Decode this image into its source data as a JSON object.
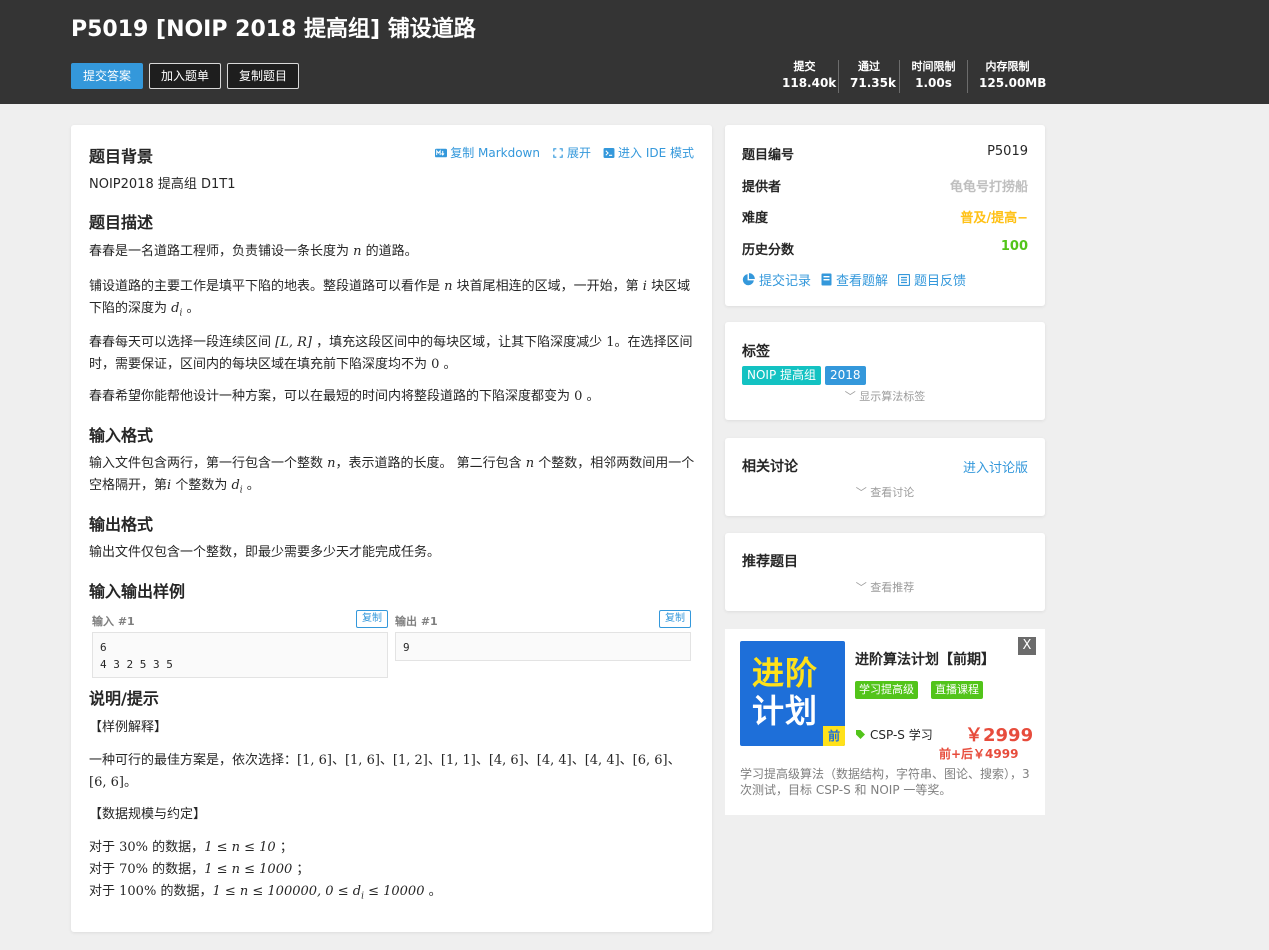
{
  "header": {
    "title": "P5019 [NOIP 2018 提高组] 铺设道路",
    "buttons": {
      "submit": "提交答案",
      "add_list": "加入题单",
      "copy": "复制题目"
    },
    "stats": [
      {
        "label": "提交",
        "value": "118.40k"
      },
      {
        "label": "通过",
        "value": "71.35k"
      },
      {
        "label": "时间限制",
        "value": "1.00s"
      },
      {
        "label": "内存限制",
        "value": "125.00MB"
      }
    ]
  },
  "problem": {
    "actions": {
      "copy_md": "复制 Markdown",
      "expand": "展开",
      "ide": "进入 IDE 模式"
    },
    "background": {
      "heading": "题目背景",
      "text": "NOIP2018 提高组 D1T1"
    },
    "description": {
      "heading": "题目描述",
      "p1a": "春春是一名道路工程师，负责铺设一条长度为 ",
      "p1_n": "n",
      "p1b": " 的道路。",
      "p2a": "铺设道路的主要工作是填平下陷的地表。整段道路可以看作是 ",
      "p2_n": "n",
      "p2b": " 块首尾相连的区域，一开始，第 ",
      "p2_i": "i",
      "p2c": " 块区域下陷的深度为 ",
      "p2_d": "d",
      "p2_sub": "i",
      "p2d": " 。",
      "p3a": "春春每天可以选择一段连续区间 ",
      "p3_lr": "[L, R]",
      "p3b": " ，填充这段区间中的每块区域，让其下陷深度减少 ",
      "p3_one": "1",
      "p3c": "。在选择区间时，需要保证，区间内的每块区域在填充前下陷深度均不为 ",
      "p3_zero": "0",
      "p3d": " 。",
      "p4a": "春春希望你能帮他设计一种方案，可以在最短的时间内将整段道路的下陷深度都变为 ",
      "p4_zero": "0",
      "p4b": " 。"
    },
    "input_format": {
      "heading": "输入格式",
      "a": "输入文件包含两行，第一行包含一个整数 ",
      "n1": "n",
      "b": "，表示道路的长度。 第二行包含 ",
      "n2": "n",
      "c": " 个整数，相邻两数间用一个空格隔开，第",
      "i": "i",
      "d": " 个整数为 ",
      "di": "d",
      "di_sub": "i",
      "e": " 。"
    },
    "output_format": {
      "heading": "输出格式",
      "text": "输出文件仅包含一个整数，即最少需要多少天才能完成任务。"
    },
    "samples": {
      "heading": "输入输出样例",
      "input_label": "输入 #1",
      "output_label": "输出 #1",
      "copy": "复制",
      "input_line1": "6",
      "input_line2": "4 3 2 5 3 5",
      "output": "9"
    },
    "hint": {
      "heading": "说明/提示",
      "sample_expl": "【样例解释】",
      "plan_a": "一种可行的最佳方案是，依次选择：",
      "plan_m1": "[1, 6]、[1, 6]、[1, 2]、[1, 1]、[4, 6]、[4, 4]、[4, 4]、[6, 6]、",
      "plan_m2": "[6, 6]",
      "plan_b": "。",
      "scale": "【数据规模与约定】",
      "r1a": "对于 ",
      "r1p": "30%",
      "r1b": " 的数据，",
      "r1m": "1 ≤ n ≤ 10",
      "r1c": " ；",
      "r2a": "对于 ",
      "r2p": "70%",
      "r2b": " 的数据，",
      "r2m": "1 ≤ n ≤ 1000",
      "r2c": " ；",
      "r3a": "对于 ",
      "r3p": "100%",
      "r3b": " 的数据，",
      "r3m1": "1 ≤ n ≤ 100000, 0 ≤ d",
      "r3sub": "i",
      "r3m2": " ≤ 10000",
      "r3c": " 。"
    }
  },
  "info": {
    "id": {
      "label": "题目编号",
      "value": "P5019"
    },
    "provider": {
      "label": "提供者",
      "value": "龟龟号打捞船"
    },
    "difficulty": {
      "label": "难度",
      "value": "普及/提高−"
    },
    "score": {
      "label": "历史分数",
      "value": "100"
    },
    "links": {
      "records": "提交记录",
      "solutions": "查看题解",
      "feedback": "题目反馈"
    }
  },
  "tags": {
    "heading": "标签",
    "items": [
      "NOIP 提高组",
      "2018"
    ],
    "more": "显示算法标签"
  },
  "discussion": {
    "heading": "相关讨论",
    "link": "进入讨论版",
    "more": "查看讨论"
  },
  "recommend": {
    "heading": "推荐题目",
    "more": "查看推荐"
  },
  "ad": {
    "img_line1": "进阶",
    "img_line2": "计划",
    "img_badge": "前",
    "close": "X",
    "title": "进阶算法计划【前期】",
    "tags": [
      "学习提高级",
      "直播课程"
    ],
    "course": "CSP-S 学习",
    "price": "￥2999",
    "price_combo": "前+后￥4999",
    "desc": "学习提高级算法（数据结构，字符串、图论、搜索），3 次测试，目标 CSP-S 和 NOIP 一等奖。"
  },
  "colors": {
    "accent": "#3498db",
    "header_bg": "#343434",
    "difficulty": "#ffc116",
    "score": "#52c41a",
    "tag_noip": "#13c2c2",
    "tag_year": "#3498db",
    "price": "#e74c3c",
    "provider": "#bfbfbf"
  }
}
